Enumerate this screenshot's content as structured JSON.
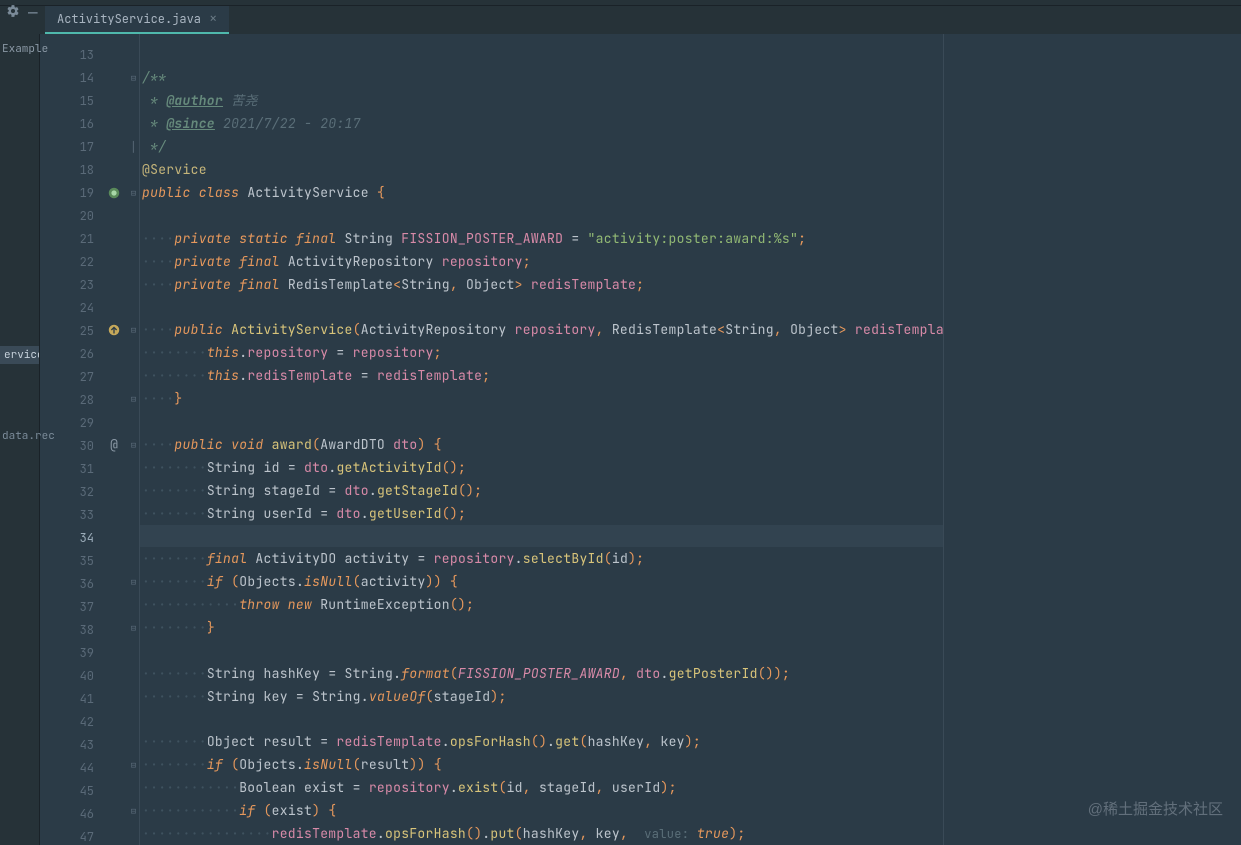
{
  "tab": {
    "filename": "ActivityService.java",
    "close_glyph": "×"
  },
  "sidebar": {
    "label_top": "Example",
    "item_active": "ervice",
    "item_2": "data.rec"
  },
  "line_numbers": [
    "13",
    "14",
    "15",
    "16",
    "17",
    "18",
    "19",
    "20",
    "21",
    "22",
    "23",
    "24",
    "25",
    "26",
    "27",
    "28",
    "29",
    "30",
    "31",
    "32",
    "33",
    "34",
    "35",
    "36",
    "37",
    "38",
    "39",
    "40",
    "41",
    "42",
    "43",
    "44",
    "45",
    "46",
    "47"
  ],
  "gutter_icons": {
    "19": "bean",
    "25": "override",
    "30": "at"
  },
  "fold_marks": {
    "14": "open",
    "17": "bar",
    "19": "open",
    "25": "open",
    "28": "close",
    "30": "open",
    "36": "open",
    "38": "close",
    "44": "open",
    "46": "open"
  },
  "current_line": "34",
  "code": {
    "13": "",
    "14": {
      "raw": "/**"
    },
    "15": {
      "indent": " ",
      "tag": "@author",
      "text": " 苦尧"
    },
    "16": {
      "indent": " ",
      "tag": "@since",
      "text": " 2021/7/22 - 20:17"
    },
    "17": {
      "raw": " */"
    },
    "18": {
      "anno": "@Service"
    },
    "19": {
      "kw1": "public ",
      "kw2": "class ",
      "name": "ActivityService ",
      "brace": "{"
    },
    "20": "",
    "21": {
      "ws": "····",
      "kw": "private static final ",
      "type": "String ",
      "name": "FISSION_POSTER_AWARD",
      "op": " = ",
      "str": "\"activity:poster:award:%s\"",
      "semi": ";"
    },
    "22": {
      "ws": "····",
      "kw": "private final ",
      "type": "ActivityRepository ",
      "name": "repository",
      "semi": ";"
    },
    "23": {
      "ws": "····",
      "kw": "private final ",
      "type": "RedisTemplate",
      "generic": "<String, Object> ",
      "name": "redisTemplate",
      "semi": ";"
    },
    "24": "",
    "25": {
      "ws": "····",
      "kw": "public ",
      "name": "ActivityService",
      "params": "(ActivityRepository repository, RedisTemplate<String, Object> redisTemplate) ",
      "brace": "{"
    },
    "26": {
      "ws": "········",
      "this": "this",
      "dot": ".",
      "field": "repository",
      "op": " = ",
      "param": "repository",
      "semi": ";"
    },
    "27": {
      "ws": "········",
      "this": "this",
      "dot": ".",
      "field": "redisTemplate",
      "op": " = ",
      "param": "redisTemplate",
      "semi": ";"
    },
    "28": {
      "ws": "····",
      "brace": "}"
    },
    "29": "",
    "30": {
      "ws": "····",
      "kw": "public void ",
      "name": "award",
      "params": "(AwardDTO dto) ",
      "brace": "{"
    },
    "31": {
      "ws": "········",
      "type": "String ",
      "var": "id ",
      "op": "= ",
      "obj": "dto",
      "dot": ".",
      "call": "getActivityId",
      "paren": "()",
      "semi": ";"
    },
    "32": {
      "ws": "········",
      "type": "String ",
      "var": "stageId ",
      "op": "= ",
      "obj": "dto",
      "dot": ".",
      "call": "getStageId",
      "paren": "()",
      "semi": ";"
    },
    "33": {
      "ws": "········",
      "type": "String ",
      "var": "userId ",
      "op": "= ",
      "obj": "dto",
      "dot": ".",
      "call": "getUserId",
      "paren": "()",
      "semi": ";"
    },
    "34": "",
    "35": {
      "ws": "········",
      "kw": "final ",
      "type": "ActivityDO ",
      "var": "activity ",
      "op": "= ",
      "obj": "repository",
      "dot": ".",
      "call": "selectById",
      "args": "(id)",
      "semi": ";"
    },
    "36": {
      "ws": "········",
      "kw": "if ",
      "open": "(",
      "obj": "Objects",
      "dot": ".",
      "call": "isNull",
      "args": "(activity)",
      "close": ") ",
      "brace": "{"
    },
    "37": {
      "ws": "············",
      "kw": "throw new ",
      "type": "RuntimeException",
      "paren": "()",
      "semi": ";"
    },
    "38": {
      "ws": "········",
      "brace": "}"
    },
    "39": "",
    "40": {
      "ws": "········",
      "type": "String ",
      "var": "hashKey ",
      "op": "= ",
      "obj": "String",
      "dot": ".",
      "call": "format",
      "open": "(",
      "const": "FISSION_POSTER_AWARD",
      "comma": ", ",
      "obj2": "dto",
      "dot2": ".",
      "call2": "getPosterId",
      "paren2": "()",
      "close": ")",
      "semi": ";"
    },
    "41": {
      "ws": "········",
      "type": "String ",
      "var": "key ",
      "op": "= ",
      "obj": "String",
      "dot": ".",
      "call": "valueOf",
      "args": "(stageId)",
      "semi": ";"
    },
    "42": "",
    "43": {
      "ws": "········",
      "type": "Object ",
      "var": "result ",
      "op": "= ",
      "obj": "redisTemplate",
      "dot": ".",
      "call": "opsForHash",
      "paren": "()",
      "dot2": ".",
      "call2": "get",
      "args": "(hashKey, key)",
      "semi": ";"
    },
    "44": {
      "ws": "········",
      "kw": "if ",
      "open": "(",
      "obj": "Objects",
      "dot": ".",
      "call": "isNull",
      "args": "(result)",
      "close": ") ",
      "brace": "{"
    },
    "45": {
      "ws": "············",
      "type": "Boolean ",
      "var": "exist ",
      "op": "= ",
      "obj": "repository",
      "dot": ".",
      "call": "exist",
      "args": "(id, stageId, userId)",
      "semi": ";"
    },
    "46": {
      "ws": "············",
      "kw": "if ",
      "open": "(",
      "var": "exist",
      "close": ") ",
      "brace": "{"
    },
    "47": {
      "ws": "················",
      "obj": "redisTemplate",
      "dot": ".",
      "call": "opsForHash",
      "paren": "()",
      "dot2": ".",
      "call2": "put",
      "args_pre": "(hashKey, key, ",
      "hint": "value: ",
      "bool": "true",
      "args_post": ")",
      "semi": ";"
    }
  },
  "watermark": "@稀土掘金技术社区"
}
